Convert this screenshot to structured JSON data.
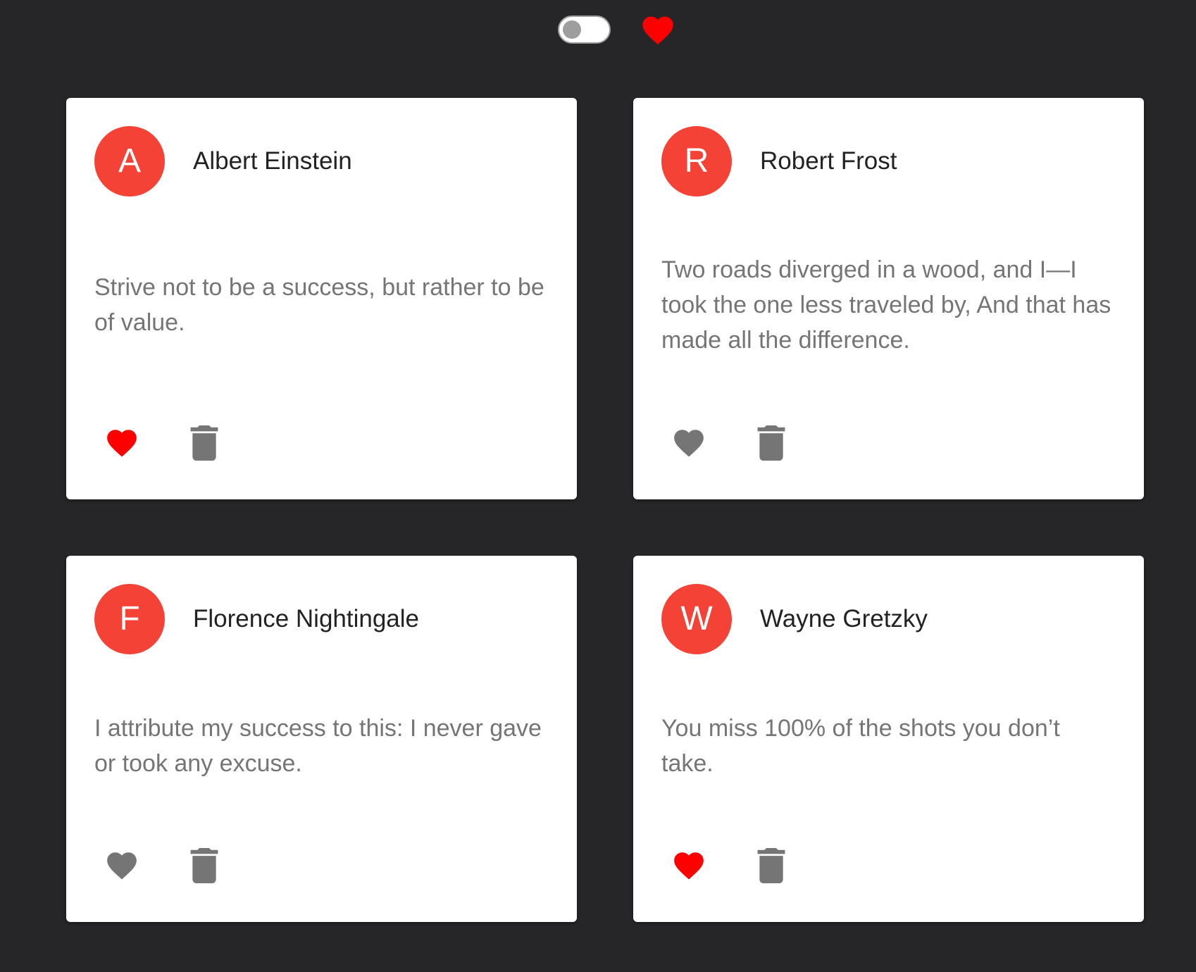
{
  "colors": {
    "background": "#262527",
    "card": "#ffffff",
    "avatar": "#f44336",
    "liked": "#ff0000",
    "icon_inactive": "#757575",
    "toggle_track": "#ffffff",
    "toggle_knob": "#9e9e9e"
  },
  "topbar": {
    "filter_toggle": {
      "on": false
    },
    "favorites_filter_icon": "heart-icon"
  },
  "quotes": [
    {
      "initial": "A",
      "author": "Albert Einstein",
      "text": "Strive not to be a success, but rather to be of value.",
      "liked": true
    },
    {
      "initial": "R",
      "author": "Robert Frost",
      "text": "Two roads diverged in a wood, and I—I took the one less traveled by, And that has made all the difference.",
      "liked": false
    },
    {
      "initial": "F",
      "author": "Florence Nightingale",
      "text": "I attribute my success to this: I never gave or took any excuse.",
      "liked": false
    },
    {
      "initial": "W",
      "author": "Wayne Gretzky",
      "text": "You miss 100% of the shots you don’t take.",
      "liked": true
    }
  ],
  "icons": {
    "like": "heart-icon",
    "delete": "trash-icon"
  }
}
